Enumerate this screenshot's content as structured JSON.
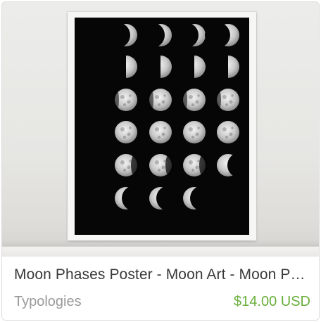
{
  "listing": {
    "title": "Moon Phases Poster - Moon Art - Moon Phases Print",
    "shop_name": "Typologies",
    "price": "$14.00 USD"
  },
  "colors": {
    "price": "#6aaf3c",
    "poster_background": "#060606",
    "moon": "#d8d8d8"
  },
  "poster": {
    "phases": [
      [
        "wax-thin",
        "wax-thin",
        "wax-thin",
        "wax-crescent"
      ],
      [
        "first-quarter",
        "first-quarter",
        "first-quarter",
        "first-quarter"
      ],
      [
        "gibbous",
        "gibbous",
        "gibbous",
        "gibbous"
      ],
      [
        "full",
        "full",
        "full",
        "full"
      ],
      [
        "wane-gibbous",
        "wane-gibbous",
        "wane-gibbous",
        "wane-crescent"
      ],
      [
        "wane-thin",
        "wane-thin",
        "wane-thin"
      ]
    ]
  }
}
